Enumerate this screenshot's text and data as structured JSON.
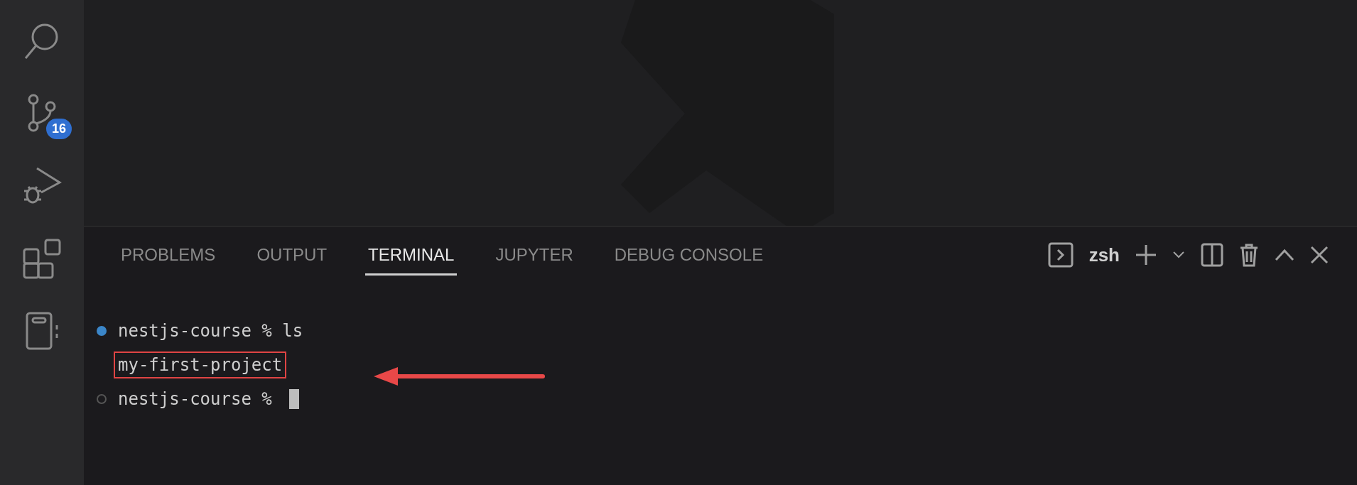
{
  "activity_bar": [
    {
      "kind": "search"
    },
    {
      "kind": "source-control",
      "badge": "16"
    },
    {
      "kind": "run-debug"
    },
    {
      "kind": "extensions"
    },
    {
      "kind": "notebook"
    }
  ],
  "panel": {
    "tabs": [
      {
        "label": "PROBLEMS",
        "selected": false
      },
      {
        "label": "OUTPUT",
        "selected": false
      },
      {
        "label": "TERMINAL",
        "selected": true
      },
      {
        "label": "JUPYTER",
        "selected": false
      },
      {
        "label": "DEBUG CONSOLE",
        "selected": false
      }
    ],
    "shell": "zsh"
  },
  "terminal": {
    "lines": [
      {
        "kind": "prompt",
        "succeeded": true,
        "text": "nestjs-course % ls"
      },
      {
        "kind": "output",
        "text": "my-first-project",
        "highlighted": true
      },
      {
        "kind": "prompt",
        "succeeded": false,
        "text": "nestjs-course %",
        "cursor": true
      }
    ]
  }
}
